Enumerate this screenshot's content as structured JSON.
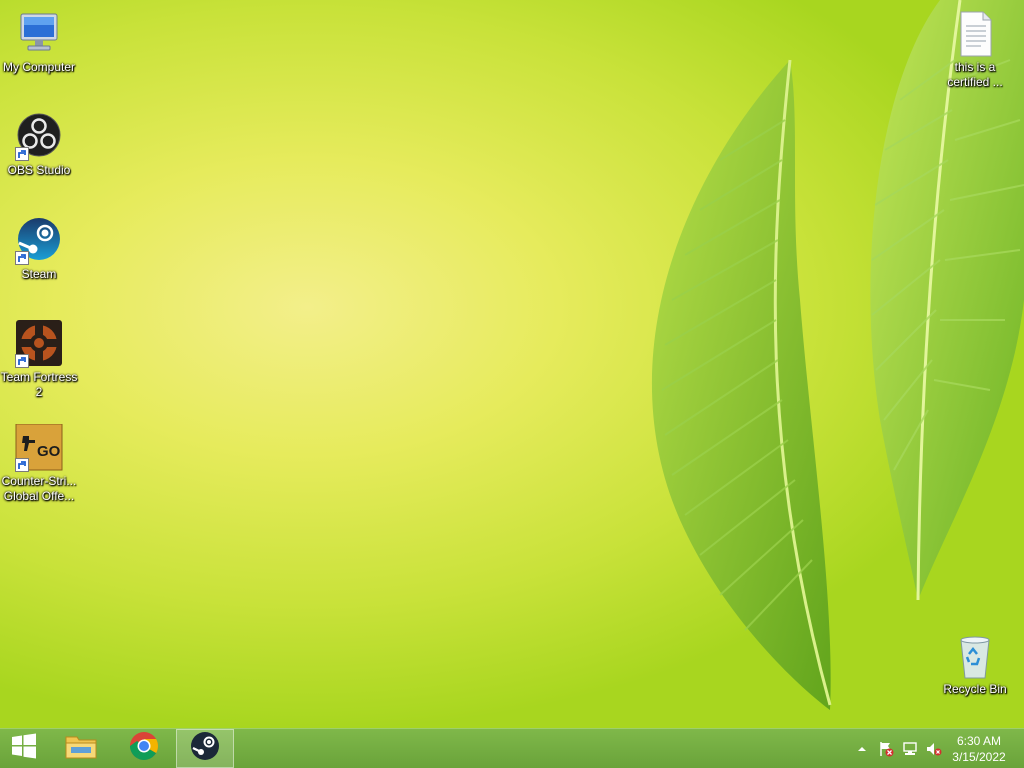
{
  "desktop": {
    "icons": [
      {
        "label": "My Computer"
      },
      {
        "label": "OBS Studio"
      },
      {
        "label": "Steam"
      },
      {
        "label": "Team Fortress 2"
      },
      {
        "label": "Counter-Stri... Global Offe..."
      },
      {
        "label": "this is a certified ..."
      },
      {
        "label": "Recycle Bin"
      }
    ]
  },
  "taskbar": {
    "pinned": [
      "start-button",
      "file-explorer",
      "google-chrome",
      "steam"
    ],
    "active_app": "steam",
    "tray_icons": [
      "show-hidden-icons",
      "action-center-flag-icon",
      "network-icon",
      "volume-muted-icon"
    ]
  },
  "clock": {
    "time": "6:30 AM",
    "date": "3/15/2022"
  },
  "colors": {
    "taskbar": "#74ad42",
    "wallpaper_light": "#f3ef8a",
    "wallpaper_green": "#a8d61f",
    "leaf": "#6fb62a"
  }
}
